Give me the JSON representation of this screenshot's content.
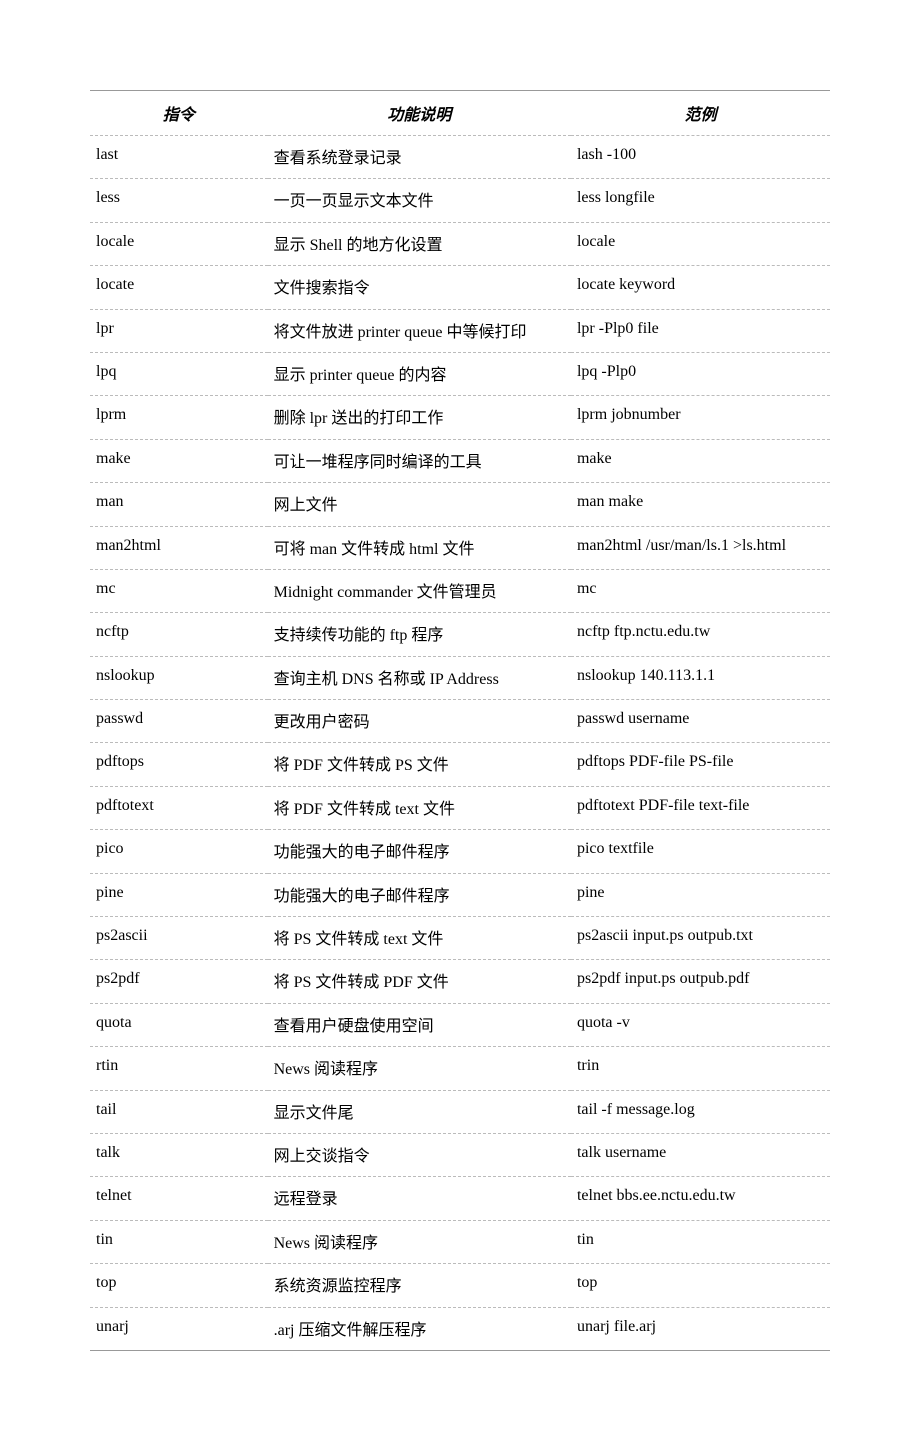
{
  "headers": {
    "command": "指令",
    "description": "功能说明",
    "example": "范例"
  },
  "rows": [
    {
      "command": "last",
      "description": "查看系统登录记录",
      "example": "lash -100"
    },
    {
      "command": "less",
      "description": "一页一页显示文本文件",
      "example": "less longfile"
    },
    {
      "command": "locale",
      "description": "显示 Shell 的地方化设置",
      "example": "locale"
    },
    {
      "command": "locate",
      "description": "文件搜索指令",
      "example": "locate keyword"
    },
    {
      "command": "lpr",
      "description": "将文件放进 printer queue 中等候打印",
      "example": "lpr -Plp0 file"
    },
    {
      "command": "lpq",
      "description": "显示 printer queue 的内容",
      "example": "lpq -Plp0"
    },
    {
      "command": "lprm",
      "description": "删除 lpr 送出的打印工作",
      "example": "lprm jobnumber"
    },
    {
      "command": "make",
      "description": "可让一堆程序同时编译的工具",
      "example": "make"
    },
    {
      "command": "man",
      "description": "网上文件",
      "example": "man make"
    },
    {
      "command": "man2html",
      "description": "可将 man 文件转成 html 文件",
      "example": "man2html /usr/man/ls.1 >ls.html"
    },
    {
      "command": "mc",
      "description": "Midnight commander 文件管理员",
      "example": "mc"
    },
    {
      "command": "ncftp",
      "description": "支持续传功能的 ftp 程序",
      "example": "ncftp ftp.nctu.edu.tw"
    },
    {
      "command": "nslookup",
      "description": "查询主机 DNS 名称或 IP Address",
      "example": "nslookup 140.113.1.1"
    },
    {
      "command": "passwd",
      "description": "更改用户密码",
      "example": "passwd username"
    },
    {
      "command": "pdftops",
      "description": "将 PDF 文件转成 PS 文件",
      "example": "pdftops PDF-file PS-file"
    },
    {
      "command": "pdftotext",
      "description": "将 PDF 文件转成 text 文件",
      "example": "pdftotext PDF-file text-file"
    },
    {
      "command": "pico",
      "description": "功能强大的电子邮件程序",
      "example": "pico textfile"
    },
    {
      "command": "pine",
      "description": "功能强大的电子邮件程序",
      "example": "pine"
    },
    {
      "command": "ps2ascii",
      "description": "将 PS 文件转成 text 文件",
      "example": "ps2ascii input.ps outpub.txt"
    },
    {
      "command": "ps2pdf",
      "description": "将 PS 文件转成 PDF 文件",
      "example": "ps2pdf input.ps outpub.pdf"
    },
    {
      "command": "quota",
      "description": "查看用户硬盘使用空间",
      "example": "quota -v"
    },
    {
      "command": "rtin",
      "description": "News 阅读程序",
      "example": "trin"
    },
    {
      "command": "tail",
      "description": "显示文件尾",
      "example": "tail -f message.log"
    },
    {
      "command": "talk",
      "description": "网上交谈指令",
      "example": "talk username"
    },
    {
      "command": "telnet",
      "description": "远程登录",
      "example": "telnet bbs.ee.nctu.edu.tw"
    },
    {
      "command": "tin",
      "description": "News 阅读程序",
      "example": "tin"
    },
    {
      "command": "top",
      "description": "系统资源监控程序",
      "example": "top"
    },
    {
      "command": "unarj",
      "description": ".arj 压缩文件解压程序",
      "example": "unarj file.arj"
    }
  ]
}
